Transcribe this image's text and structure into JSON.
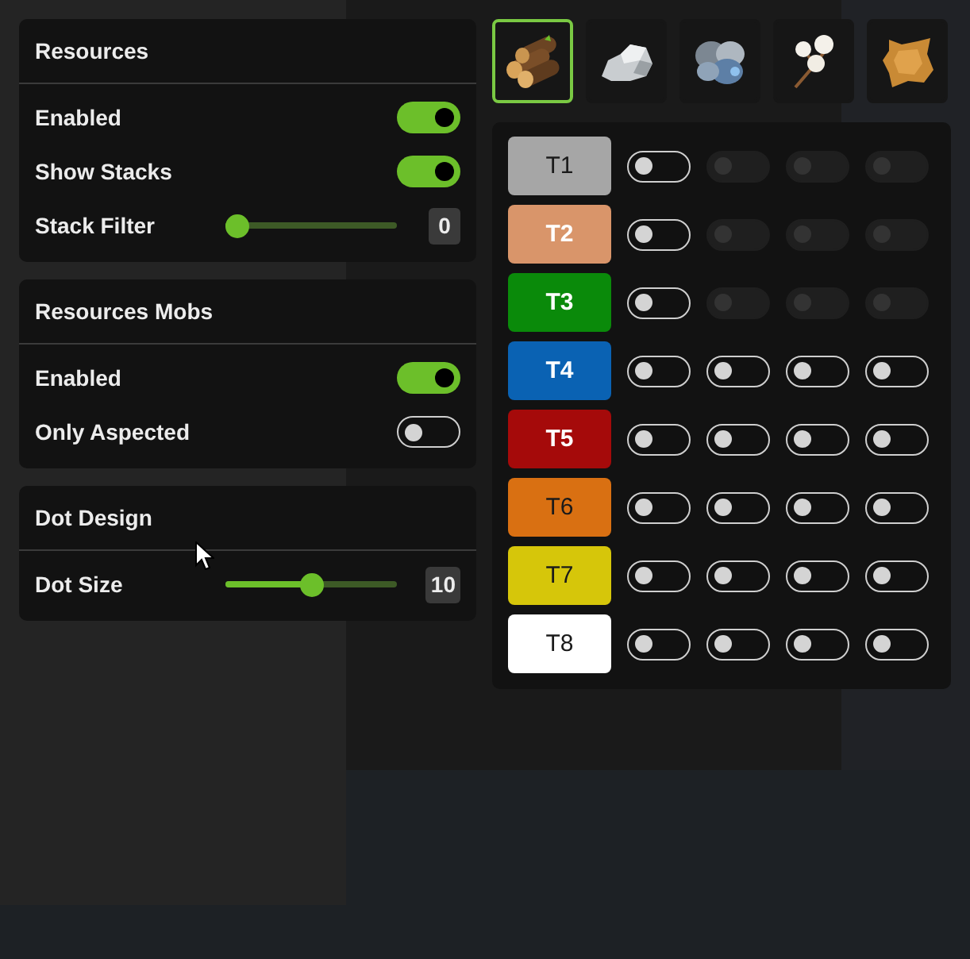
{
  "sections": [
    {
      "title": "Resources",
      "rows": [
        {
          "kind": "toggle",
          "label": "Enabled",
          "on": true
        },
        {
          "kind": "toggle",
          "label": "Show Stacks",
          "on": true
        },
        {
          "kind": "slider",
          "label": "Stack Filter",
          "level": 0,
          "reading": "0"
        }
      ]
    },
    {
      "title": "Resources Mobs",
      "rows": [
        {
          "kind": "toggle",
          "label": "Enabled",
          "on": true
        },
        {
          "kind": "toggle",
          "label": "Only Aspected",
          "on": false
        }
      ]
    },
    {
      "title": "Dot Design",
      "rows": [
        {
          "kind": "slider",
          "label": "Dot Size",
          "level": 0.51,
          "reading": "10"
        }
      ]
    }
  ],
  "resource_tabs": [
    {
      "kind": "logs",
      "selected": true
    },
    {
      "kind": "stone",
      "selected": false
    },
    {
      "kind": "ore",
      "selected": false
    },
    {
      "kind": "fiber",
      "selected": false
    },
    {
      "kind": "hide",
      "selected": false
    }
  ],
  "tiers": [
    {
      "label": "T1",
      "color": "#a6a6a6",
      "dark_label": true,
      "toggles": [
        {
          "on": false,
          "disabled": false
        },
        {
          "on": false,
          "disabled": true
        },
        {
          "on": false,
          "disabled": true
        },
        {
          "on": false,
          "disabled": true
        }
      ]
    },
    {
      "label": "T2",
      "color": "#d9956a",
      "dark_label": false,
      "toggles": [
        {
          "on": false,
          "disabled": false
        },
        {
          "on": false,
          "disabled": true
        },
        {
          "on": false,
          "disabled": true
        },
        {
          "on": false,
          "disabled": true
        }
      ]
    },
    {
      "label": "T3",
      "color": "#0a8a0a",
      "dark_label": false,
      "toggles": [
        {
          "on": false,
          "disabled": false
        },
        {
          "on": false,
          "disabled": true
        },
        {
          "on": false,
          "disabled": true
        },
        {
          "on": false,
          "disabled": true
        }
      ]
    },
    {
      "label": "T4",
      "color": "#0a62b3",
      "dark_label": false,
      "toggles": [
        {
          "on": false,
          "disabled": false
        },
        {
          "on": false,
          "disabled": false
        },
        {
          "on": false,
          "disabled": false
        },
        {
          "on": false,
          "disabled": false
        }
      ]
    },
    {
      "label": "T5",
      "color": "#a50a0a",
      "dark_label": false,
      "toggles": [
        {
          "on": false,
          "disabled": false
        },
        {
          "on": false,
          "disabled": false
        },
        {
          "on": false,
          "disabled": false
        },
        {
          "on": false,
          "disabled": false
        }
      ]
    },
    {
      "label": "T6",
      "color": "#d97012",
      "dark_label": true,
      "toggles": [
        {
          "on": false,
          "disabled": false
        },
        {
          "on": false,
          "disabled": false
        },
        {
          "on": false,
          "disabled": false
        },
        {
          "on": false,
          "disabled": false
        }
      ]
    },
    {
      "label": "T7",
      "color": "#d6c60a",
      "dark_label": true,
      "toggles": [
        {
          "on": false,
          "disabled": false
        },
        {
          "on": false,
          "disabled": false
        },
        {
          "on": false,
          "disabled": false
        },
        {
          "on": false,
          "disabled": false
        }
      ]
    },
    {
      "label": "T8",
      "color": "#ffffff",
      "dark_label": true,
      "toggles": [
        {
          "on": false,
          "disabled": false
        },
        {
          "on": false,
          "disabled": false
        },
        {
          "on": false,
          "disabled": false
        },
        {
          "on": false,
          "disabled": false
        }
      ]
    }
  ]
}
